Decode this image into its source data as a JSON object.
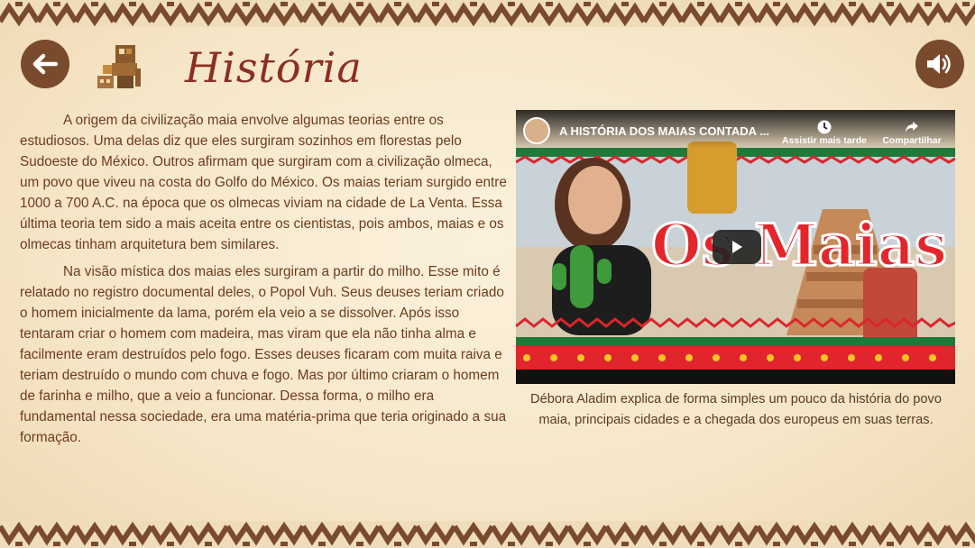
{
  "page": {
    "title": "História",
    "back_icon": "arrow-left-icon",
    "sound_icon": "speaker-volume-icon",
    "decor_icon": "mayan-glyph-icon"
  },
  "article": {
    "paragraphs": [
      "A origem da civilização maia envolve algumas teorias entre os estudiosos. Uma delas diz que eles surgiram sozinhos em florestas pelo Sudoeste do México. Outros afirmam que surgiram com a civilização olmeca, um povo que viveu na costa do Golfo do México. Os maias teriam surgido entre 1000 a 700 A.C. na época que os olmecas viviam na cidade de La Venta. Essa última teoria tem sido a mais aceita entre os cientistas, pois ambos, maias e os olmecas tinham arquitetura bem similares.",
      "Na visão mística dos maias eles surgiram a partir do milho. Esse mito é relatado no registro documental deles, o Popol Vuh. Seus deuses teriam criado o homem inicialmente da lama, porém ela veio a se dissolver. Após isso tentaram criar o homem com madeira, mas viram que ela não tinha alma e facilmente eram destruídos pelo fogo. Esses deuses ficaram com muita raiva e teriam destruído o mundo com chuva e fogo. Mas por último criaram o homem de farinha e milho, que a veio a funcionar. Dessa forma, o milho era fundamental nessa sociedade, era uma matéria-prima que teria originado a sua formação."
    ]
  },
  "video": {
    "title": "A HISTÓRIA DOS MAIAS CONTADA ...",
    "watch_later": "Assistir mais tarde",
    "share": "Compartilhar",
    "thumbnail_text": "Os Maias",
    "caption": "Débora Aladim explica de forma simples um pouco da história do povo maia, principais cidades e a chegada dos europeus em suas terras."
  },
  "colors": {
    "accent": "#8a2f22",
    "button": "#7a4a2c",
    "text": "#6e3b1f",
    "background": "#f6e6c8"
  }
}
